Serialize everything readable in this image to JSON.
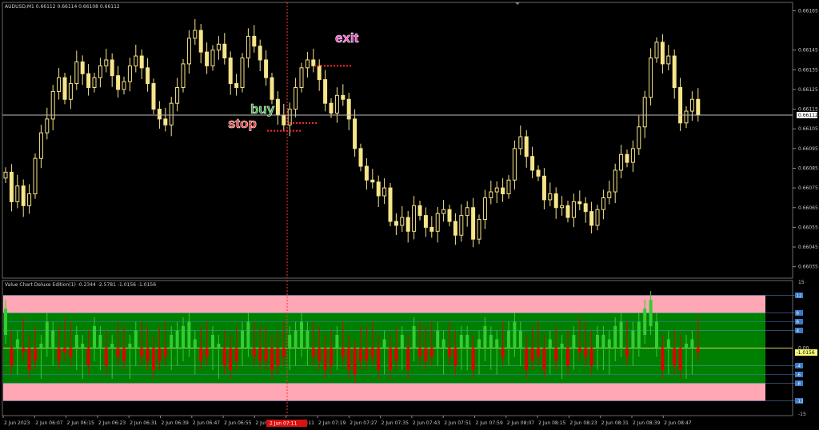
{
  "main_panel": {
    "title": "AUDUSD,M1  0.66112 0.66114 0.66108 0.66112",
    "price_ticks": [
      "0.66165",
      "0.66145",
      "0.66135",
      "0.66125",
      "0.66115",
      "0.66105",
      "0.66095",
      "0.66085",
      "0.66075",
      "0.66065",
      "0.66055",
      "0.66045",
      "0.66035"
    ],
    "price_range": [
      0.6603,
      0.66168
    ],
    "current_price": "0.66112",
    "current_price_value": 0.66112,
    "annotations": {
      "buy_label": "buy",
      "stop_label": "stop",
      "exit_label": "exit",
      "buy_price": 0.66108,
      "stop_price": 0.66104,
      "exit_price": 0.66137
    },
    "colors": {
      "background": "#000000",
      "candle": "#f7e58a",
      "current_line": "#bcbcbc",
      "buy": "#2ea12e",
      "stop": "#ff2b2b",
      "exit": "#ff3dc8",
      "marker_line": "#ff3333"
    }
  },
  "indicator_panel": {
    "title": "Value Chart Deluxe Edition(1) -0.2344 -2.5781 -1.0156 -1.0156",
    "axis_ticks": [
      "15",
      "0.00",
      "-15"
    ],
    "level_labels": [
      "12",
      "8",
      "6",
      "4",
      "-4",
      "-6",
      "-8",
      "-12"
    ],
    "current_value": "-1.0156",
    "range": [
      -15,
      15
    ],
    "colors": {
      "overbought_zone": "#ffa7b4",
      "neutral_zone": "#008000",
      "up_bar": "#32cd32",
      "down_bar": "#e00000",
      "zero_line": "#d6d664",
      "level_box": "#3a79c6",
      "current_box": "#ffff78"
    }
  },
  "time_axis": {
    "labels": [
      "2 Jun 2023",
      "2 Jun 06:07",
      "2 Jun 06:15",
      "2 Jun 06:23",
      "2 Jun 06:31",
      "2 Jun 06:39",
      "2 Jun 06:47",
      "2 Jun 06:55",
      "2 Jun 07:03",
      "2 Jun 07:11",
      "2 Jun 07:19",
      "2 Jun 07:27",
      "2 Jun 07:35",
      "2 Jun 07:43",
      "2 Jun 07:51",
      "2 Jun 07:59",
      "2 Jun 08:07",
      "2 Jun 08:15",
      "2 Jun 08:23",
      "2 Jun 08:31",
      "2 Jun 08:39",
      "2 Jun 08:47"
    ],
    "highlighted_label": "2 Jun 07:11",
    "highlight_color": "#dd1111"
  },
  "chart_data": {
    "type": "candlestick",
    "title": "AUDUSD,M1",
    "ylim": [
      0.6603,
      0.66168
    ],
    "close": [
      0.66083,
      0.66068,
      0.66076,
      0.66066,
      0.66072,
      0.6609,
      0.66103,
      0.6611,
      0.66124,
      0.66131,
      0.6612,
      0.66128,
      0.66139,
      0.66133,
      0.66126,
      0.66131,
      0.66137,
      0.6614,
      0.66132,
      0.66125,
      0.66129,
      0.66137,
      0.66142,
      0.66136,
      0.66128,
      0.66115,
      0.6611,
      0.66107,
      0.66118,
      0.66126,
      0.66138,
      0.66151,
      0.66155,
      0.66144,
      0.66137,
      0.66145,
      0.66148,
      0.66141,
      0.66128,
      0.66126,
      0.66141,
      0.66152,
      0.66147,
      0.6614,
      0.66131,
      0.6612,
      0.66112,
      0.66107,
      0.66115,
      0.66126,
      0.66136,
      0.6614,
      0.66137,
      0.6613,
      0.66118,
      0.66113,
      0.66122,
      0.6612,
      0.6611,
      0.66095,
      0.66086,
      0.66079,
      0.66078,
      0.66071,
      0.66075,
      0.66058,
      0.66056,
      0.6606,
      0.66053,
      0.66066,
      0.66061,
      0.66055,
      0.66053,
      0.66062,
      0.66064,
      0.66058,
      0.66051,
      0.66061,
      0.66065,
      0.66049,
      0.66059,
      0.6607,
      0.66073,
      0.66075,
      0.66072,
      0.66079,
      0.66095,
      0.66101,
      0.66091,
      0.66084,
      0.66081,
      0.66069,
      0.66072,
      0.66065,
      0.66066,
      0.6606,
      0.66068,
      0.66067,
      0.66063,
      0.66056,
      0.66064,
      0.6607,
      0.66073,
      0.66084,
      0.66092,
      0.66088,
      0.66095,
      0.66106,
      0.66121,
      0.66141,
      0.66149,
      0.66138,
      0.66142,
      0.66126,
      0.66108,
      0.66114,
      0.6612,
      0.66112
    ]
  },
  "indicator_data": {
    "type": "bar",
    "values": [
      9,
      -4,
      2,
      -1,
      -5,
      -3,
      1,
      6,
      4,
      -3,
      -1,
      -2,
      3,
      1,
      -4,
      5,
      3,
      -4,
      1,
      -2,
      -3,
      1,
      4,
      -2,
      -3,
      -5,
      -3,
      -2,
      3,
      4,
      5,
      6,
      2,
      -3,
      -2,
      3,
      1,
      -4,
      -5,
      -3,
      4,
      6,
      -2,
      -3,
      -3,
      -5,
      -4,
      -2,
      3,
      4,
      6,
      4,
      -2,
      -3,
      -5,
      -4,
      3,
      -2,
      -5,
      -6,
      -3,
      -3,
      -2,
      -5,
      2,
      -5,
      -3,
      3,
      -5,
      5,
      -2,
      -3,
      -2,
      4,
      2,
      -2,
      -4,
      3,
      3,
      -5,
      2,
      5,
      3,
      2,
      -2,
      4,
      6,
      4,
      -5,
      -3,
      -2,
      -5,
      2,
      -3,
      1,
      -4,
      3,
      -1,
      -2,
      -4,
      3,
      3,
      2,
      5,
      6,
      -2,
      4,
      6,
      9,
      11,
      6,
      -5,
      2,
      -4,
      -5,
      1,
      2,
      -1
    ]
  }
}
